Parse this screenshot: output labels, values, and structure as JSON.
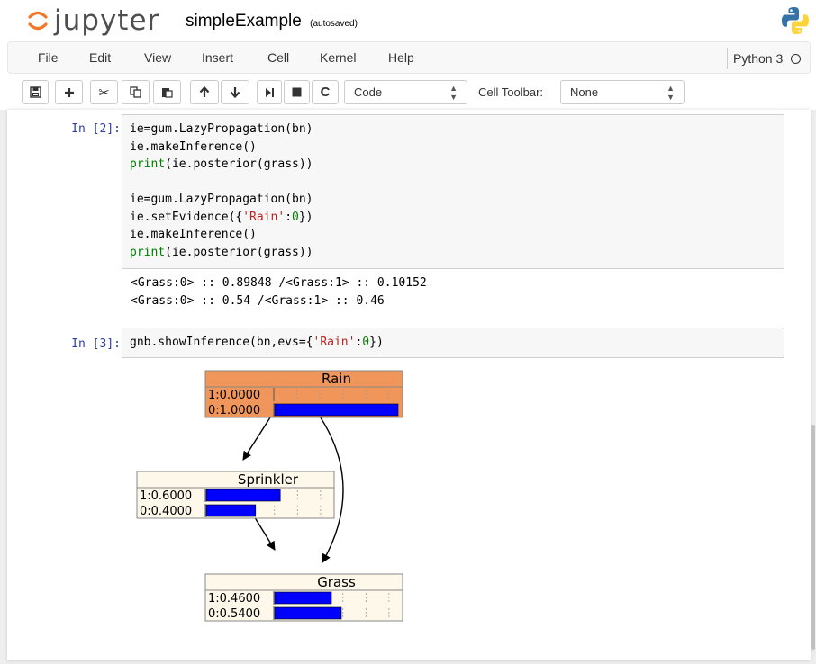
{
  "header": {
    "logo_text": "jupyter",
    "notebook_title": "simpleExample",
    "autosave_status": "(autosaved)"
  },
  "menu": {
    "items": [
      "File",
      "Edit",
      "View",
      "Insert",
      "Cell",
      "Kernel",
      "Help"
    ],
    "kernel_name": "Python 3"
  },
  "toolbar": {
    "cell_type": "Code",
    "cell_toolbar_label": "Cell Toolbar:",
    "cell_toolbar_value": "None",
    "buttons": [
      "save-icon",
      "plus-icon",
      "cut-icon",
      "copy-icon",
      "paste-icon",
      "arrow-up-icon",
      "arrow-down-icon",
      "step-icon",
      "stop-icon",
      "restart-icon"
    ]
  },
  "cells": [
    {
      "prompt": "In [2]:",
      "code_lines": [
        "ie=gum.LazyPropagation(bn)",
        "ie.makeInference()",
        "print(ie.posterior(grass))",
        "",
        "ie=gum.LazyPropagation(bn)",
        "ie.setEvidence({'Rain':0})",
        "ie.makeInference()",
        "print(ie.posterior(grass))"
      ],
      "output_lines": [
        "<Grass:0> :: 0.89848 /<Grass:1> :: 0.10152",
        "<Grass:0> :: 0.54 /<Grass:1> :: 0.46"
      ]
    },
    {
      "prompt": "In [3]:",
      "code_lines": [
        "gnb.showInference(bn,evs={'Rain':0})"
      ]
    }
  ],
  "graph": {
    "nodes": [
      {
        "name": "Rain",
        "rows": [
          {
            "label": "1:0.0000",
            "value": 0.0
          },
          {
            "label": "0:1.0000",
            "value": 1.0
          }
        ],
        "header_color": "#f0965a",
        "body_color": "#f0965a"
      },
      {
        "name": "Sprinkler",
        "rows": [
          {
            "label": "1:0.6000",
            "value": 0.6
          },
          {
            "label": "0:0.4000",
            "value": 0.4
          }
        ],
        "header_color": "#fdf8ea",
        "body_color": "#fdf8ea"
      },
      {
        "name": "Grass",
        "rows": [
          {
            "label": "1:0.4600",
            "value": 0.46
          },
          {
            "label": "0:0.5400",
            "value": 0.54
          }
        ],
        "header_color": "#fdf8ea",
        "body_color": "#fdf8ea"
      }
    ],
    "edges": [
      [
        "Rain",
        "Sprinkler"
      ],
      [
        "Rain",
        "Grass"
      ],
      [
        "Sprinkler",
        "Grass"
      ]
    ],
    "bar_color": "#0000ff"
  },
  "colors": {
    "prompt": "#303f9f",
    "python_logo_blue": "#3572a5",
    "python_logo_yellow": "#ffd43b"
  }
}
